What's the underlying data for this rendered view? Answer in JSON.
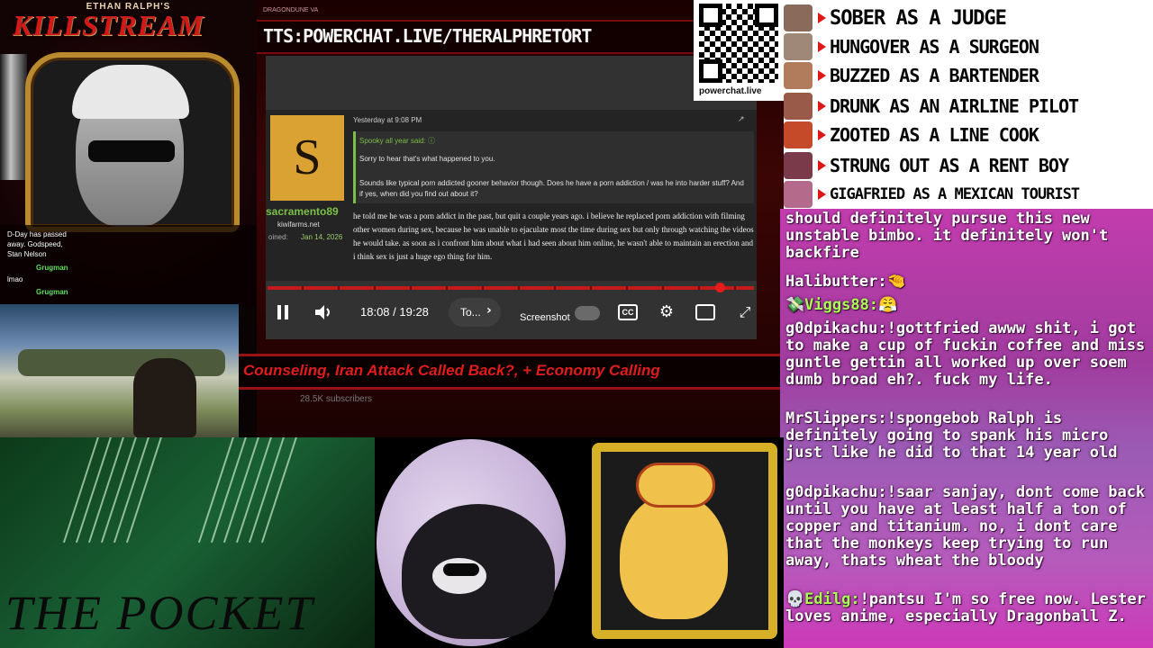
{
  "overlay": {
    "brand_top": "ETHAN RALPH'S",
    "brand_logo": "KILLSTREAM",
    "alerts": [
      "D-Day has passed",
      "away. Godspeed,",
      "Stan Nelson"
    ],
    "mini_chat": [
      {
        "user": "Grugman",
        "text": "lmao"
      },
      {
        "user": "Grugman",
        "text": ""
      }
    ],
    "tts_top": "DRAGONDUNE VA",
    "tts_url": "TTS:POWERCHAT.LIVE/THERALPHRETORT",
    "ticker": "Counseling, Iran Attack Called Back?, + Economy Calling",
    "subscribers": "28.5K subscribers",
    "qr_caption": "powerchat.live",
    "pocket_text": "THE POCKET"
  },
  "post": {
    "avatar_letter": "S",
    "username": "sacramento89",
    "site": "kiwifarms.net",
    "joined_label": "oined:",
    "joined_date": "Jan 14, 2026",
    "time": "Yesterday at 9:08 PM",
    "quote_header": "Spooky all year said: ⓘ",
    "quote_line1": "Sorry to hear that's what happened to you.",
    "quote_line2": "Sounds like typical porn addicted gooner behavior though. Does he have a porn addiction / was he into harder stuff? And if yes, when did you find out about it?",
    "reply": "he told me he was a porn addict in the past, but quit a couple years ago. i believe he replaced porn addiction with filming other women during sex, because he was unable to ejaculate most the time during sex but only through watching the videos he would take. as soon as i confront him about what i had seen about him online, he wasn't able to maintain an erection and i think sex is just a huge ego thing for him."
  },
  "player": {
    "time": "18:08 / 19:28",
    "chapter": "To...",
    "screenshot_label": "Screenshot",
    "cc_label": "CC",
    "progress": 0.93
  },
  "scale": [
    {
      "label": "SOBER AS A JUDGE",
      "thumb": "#8a6a5a"
    },
    {
      "label": "HUNGOVER AS A SURGEON",
      "thumb": "#a08878"
    },
    {
      "label": "BUZZED AS A BARTENDER",
      "thumb": "#b07c5c"
    },
    {
      "label": "DRUNK AS AN AIRLINE PILOT",
      "thumb": "#9a5a4a"
    },
    {
      "label": "ZOOTED AS A LINE COOK",
      "thumb": "#c44a2a"
    },
    {
      "label": "STRUNG OUT AS A RENT BOY",
      "thumb": "#7a3a4a"
    },
    {
      "label": "GIGAFRIED AS A MEXICAN TOURIST",
      "thumb": "#b46a8a"
    }
  ],
  "chat": [
    {
      "user": "",
      "text": "should definitely pursue this new unstable bimbo. it definitely won't backfire"
    },
    {
      "user": "Halibutter:",
      "text": "🤏"
    },
    {
      "user": "💸Viggs88:",
      "text": "😤"
    },
    {
      "user": "g0dpikachu:",
      "text": "!gottfried awww shit, i got to make a cup of fuckin coffee and miss guntle gettin all worked up over soem dumb broad eh?. fuck my life."
    },
    {
      "user": "MrSlippers:",
      "text": "!spongebob Ralph is definitely going to spank his micro just like he did to that 14 year old"
    },
    {
      "user": "g0dpikachu:",
      "text": "!saar sanjay, dont come back until you have at least half a ton of copper and titanium. no, i dont care that the monkeys keep trying to run away, thats wheat the bloody"
    },
    {
      "user": "💀Edilg:",
      "text": "!pantsu I'm so free now. Lester loves anime, especially Dragonball Z."
    }
  ]
}
